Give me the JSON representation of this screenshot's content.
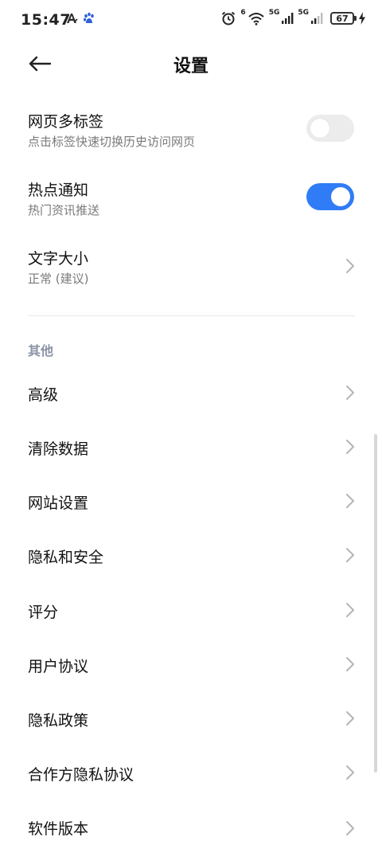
{
  "status_bar": {
    "time": "15:47",
    "left_icons": [
      "accessibility-a-icon",
      "baidu-paw-icon"
    ],
    "network_1": "5G",
    "network_2": "5G",
    "wifi_label": "6",
    "battery": "67"
  },
  "header": {
    "title": "设置"
  },
  "settings": {
    "tabs": {
      "title": "网页多标签",
      "subtitle": "点击标签快速切换历史访问网页",
      "enabled": false
    },
    "hot_notify": {
      "title": "热点通知",
      "subtitle": "热门资讯推送",
      "enabled": true
    },
    "font_size": {
      "title": "文字大小",
      "subtitle": "正常 (建议)"
    }
  },
  "other": {
    "header": "其他",
    "items": [
      {
        "label": "高级"
      },
      {
        "label": "清除数据"
      },
      {
        "label": "网站设置"
      },
      {
        "label": "隐私和安全"
      },
      {
        "label": "评分"
      },
      {
        "label": "用户协议"
      },
      {
        "label": "隐私政策"
      },
      {
        "label": "合作方隐私协议"
      },
      {
        "label": "软件版本"
      }
    ]
  },
  "colors": {
    "accent": "#2f7cf6",
    "toggle_off": "#ececec",
    "section_header": "#8a93a6"
  }
}
